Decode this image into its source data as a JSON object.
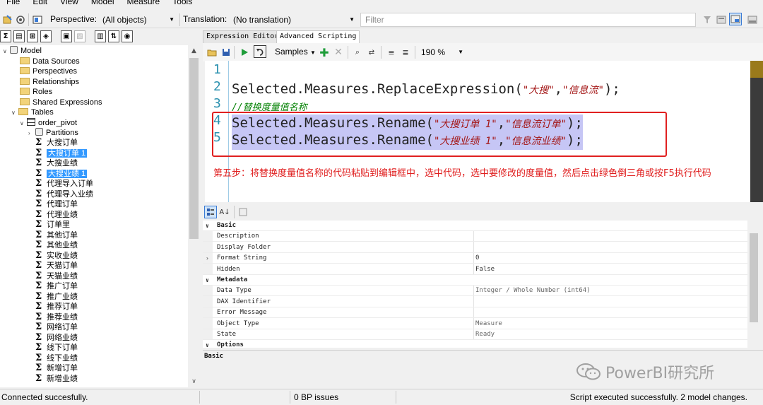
{
  "menu": {
    "file": "File",
    "edit": "Edit",
    "view": "View",
    "model": "Model",
    "measure": "Measure",
    "tools": "Tools"
  },
  "toolbar": {
    "perspective_label": "Perspective:",
    "perspective_value": "(All objects)",
    "translation_label": "Translation:",
    "translation_value": "(No translation)",
    "filter_placeholder": "Filter"
  },
  "tree": {
    "model": "Model",
    "data_sources": "Data Sources",
    "perspectives": "Perspectives",
    "relationships": "Relationships",
    "roles": "Roles",
    "shared_expressions": "Shared Expressions",
    "tables": "Tables",
    "table_name": "order_pivot",
    "partitions": "Partitions",
    "measures": [
      {
        "label": "大搜订单",
        "selected": false
      },
      {
        "label": "大搜订单 1",
        "selected": true
      },
      {
        "label": "大搜业绩",
        "selected": false
      },
      {
        "label": "大搜业绩 1",
        "selected": true
      },
      {
        "label": "代理导入订单",
        "selected": false
      },
      {
        "label": "代理导入业绩",
        "selected": false
      },
      {
        "label": "代理订单",
        "selected": false
      },
      {
        "label": "代理业绩",
        "selected": false
      },
      {
        "label": "订单里",
        "selected": false
      },
      {
        "label": "其他订单",
        "selected": false
      },
      {
        "label": "其他业绩",
        "selected": false
      },
      {
        "label": "实收业绩",
        "selected": false
      },
      {
        "label": "天猫订单",
        "selected": false
      },
      {
        "label": "天猫业绩",
        "selected": false
      },
      {
        "label": "推广订单",
        "selected": false
      },
      {
        "label": "推广业绩",
        "selected": false
      },
      {
        "label": "推荐订单",
        "selected": false
      },
      {
        "label": "推荐业绩",
        "selected": false
      },
      {
        "label": "网络订单",
        "selected": false
      },
      {
        "label": "网络业绩",
        "selected": false
      },
      {
        "label": "线下订单",
        "selected": false
      },
      {
        "label": "线下业绩",
        "selected": false
      },
      {
        "label": "新增订单",
        "selected": false
      },
      {
        "label": "新增业绩",
        "selected": false
      }
    ]
  },
  "editor": {
    "tabs": [
      "Expression Editor",
      "Advanced Scripting"
    ],
    "samples": "Samples",
    "zoom": "190 %",
    "lines": [
      "1",
      "2",
      "3",
      "4",
      "5"
    ],
    "line2": {
      "prefix": "Selected.Measures.ReplaceExpression(",
      "a": "\"大搜\"",
      "comma": ",",
      "b": "\"信息流\"",
      "suffix": ");"
    },
    "line3": "//替换度量值名称",
    "line4": {
      "prefix": "Selected.Measures.Rename(",
      "a": "\"大搜订单 1\"",
      "comma": ",",
      "b": "\"信息流订单\"",
      "suffix": ");"
    },
    "line5": {
      "prefix": "Selected.Measures.Rename(",
      "a": "\"大搜业绩 1\"",
      "comma": ",",
      "b": "\"信息流业绩\"",
      "suffix": ");"
    },
    "annotation": "第五步：将替换度量值名称的代码粘贴到编辑框中，选中代码，选中要修改的度量值，然后点击绿色倒三角或按F5执行代码"
  },
  "properties": {
    "rows": [
      {
        "type": "cat",
        "name": "Basic",
        "value": ""
      },
      {
        "type": "prop",
        "name": "Description",
        "value": ""
      },
      {
        "type": "prop",
        "name": "Display Folder",
        "value": ""
      },
      {
        "type": "prop",
        "name": "Format String",
        "value": "0",
        "expandable": true
      },
      {
        "type": "prop",
        "name": "Hidden",
        "value": "False"
      },
      {
        "type": "cat",
        "name": "Metadata",
        "value": ""
      },
      {
        "type": "prop",
        "name": "Data Type",
        "value": "Integer / Whole Number (int64)",
        "grey": true
      },
      {
        "type": "prop",
        "name": "DAX Identifier",
        "value": "",
        "grey": true
      },
      {
        "type": "prop",
        "name": "Error Message",
        "value": "",
        "grey": true
      },
      {
        "type": "prop",
        "name": "Object Type",
        "value": "Measure",
        "grey": true
      },
      {
        "type": "prop",
        "name": "State",
        "value": "Ready",
        "grey": true
      },
      {
        "type": "cat",
        "name": "Options",
        "value": ""
      }
    ],
    "description_title": "Basic"
  },
  "watermark": "PowerBI研究所",
  "status": {
    "left": "Connected succesfully.",
    "mid": "0 BP issues",
    "right": "Script executed successfully. 2 model changes."
  }
}
